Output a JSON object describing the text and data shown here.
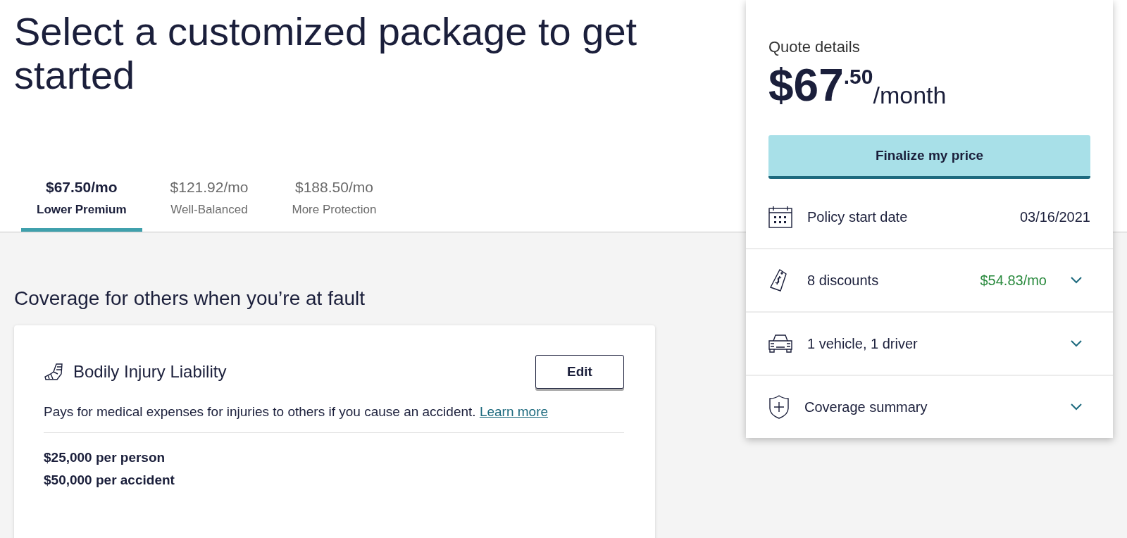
{
  "heading": "Select a customized package to get started",
  "packages": [
    {
      "price": "$67.50/mo",
      "name": "Lower Premium",
      "selected": true
    },
    {
      "price": "$121.92/mo",
      "name": "Well-Balanced",
      "selected": false
    },
    {
      "price": "$188.50/mo",
      "name": "More Protection",
      "selected": false
    }
  ],
  "section_title": "Coverage for others when you’re at fault",
  "coverage_card": {
    "title": "Bodily Injury Liability",
    "edit_button": "Edit",
    "description": "Pays for medical expenses for injuries to others if you cause an accident.",
    "link": "Learn more",
    "limits": [
      "$25,000 per person",
      "$50,000 per accident"
    ]
  },
  "quote": {
    "title": "Quote details",
    "price_main": "$67",
    "price_cents": ".50",
    "price_unit": "/month",
    "button": "Finalize my price",
    "rows": [
      {
        "kind": "date",
        "label": "Policy start date",
        "value": "03/16/2021"
      },
      {
        "kind": "discounts",
        "label": "8 discounts",
        "value": "$54.83/mo",
        "expanded": false
      },
      {
        "kind": "vehicles",
        "label": "1 vehicle, 1 driver",
        "expanded": false
      },
      {
        "kind": "coverage",
        "label": "Coverage summary",
        "expanded": false
      }
    ]
  }
}
